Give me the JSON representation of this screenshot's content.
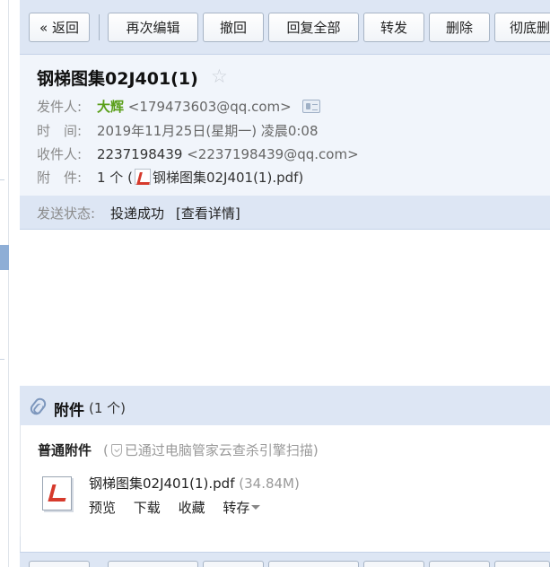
{
  "toolbar": {
    "back": "« 返回",
    "edit_again": "再次编辑",
    "recall": "撤回",
    "reply_all": "回复全部",
    "forward": "转发",
    "delete": "删除",
    "delete_permanent": "彻底删除"
  },
  "mail": {
    "subject": "钢梯图集02J401(1)",
    "from_label": "发件人:",
    "from_name": "大辉",
    "from_email": "<179473603@qq.com>",
    "time_label": "时　间:",
    "time_value": "2019年11月25日(星期一) 凌晨0:08",
    "to_label": "收件人:",
    "to_name": "2237198439",
    "to_email": "<2237198439@qq.com>",
    "attach_label": "附　件:",
    "attach_count": "1 个 (",
    "attach_file": "钢梯图集02J401(1).pdf",
    "attach_close": ")"
  },
  "status": {
    "label": "发送状态:",
    "value": "投递成功",
    "detail": "[查看详情]"
  },
  "attachments": {
    "title": "附件",
    "count": "(1 个)",
    "normal_label": "普通附件",
    "scan_prefix": "(",
    "scan_text": "已通过电脑管家云查杀引擎扫描)",
    "file_name": "钢梯图集02J401(1).pdf",
    "file_size": "(34.84M)",
    "actions": {
      "preview": "预览",
      "download": "下载",
      "collect": "收藏",
      "save_to": "转存"
    }
  }
}
